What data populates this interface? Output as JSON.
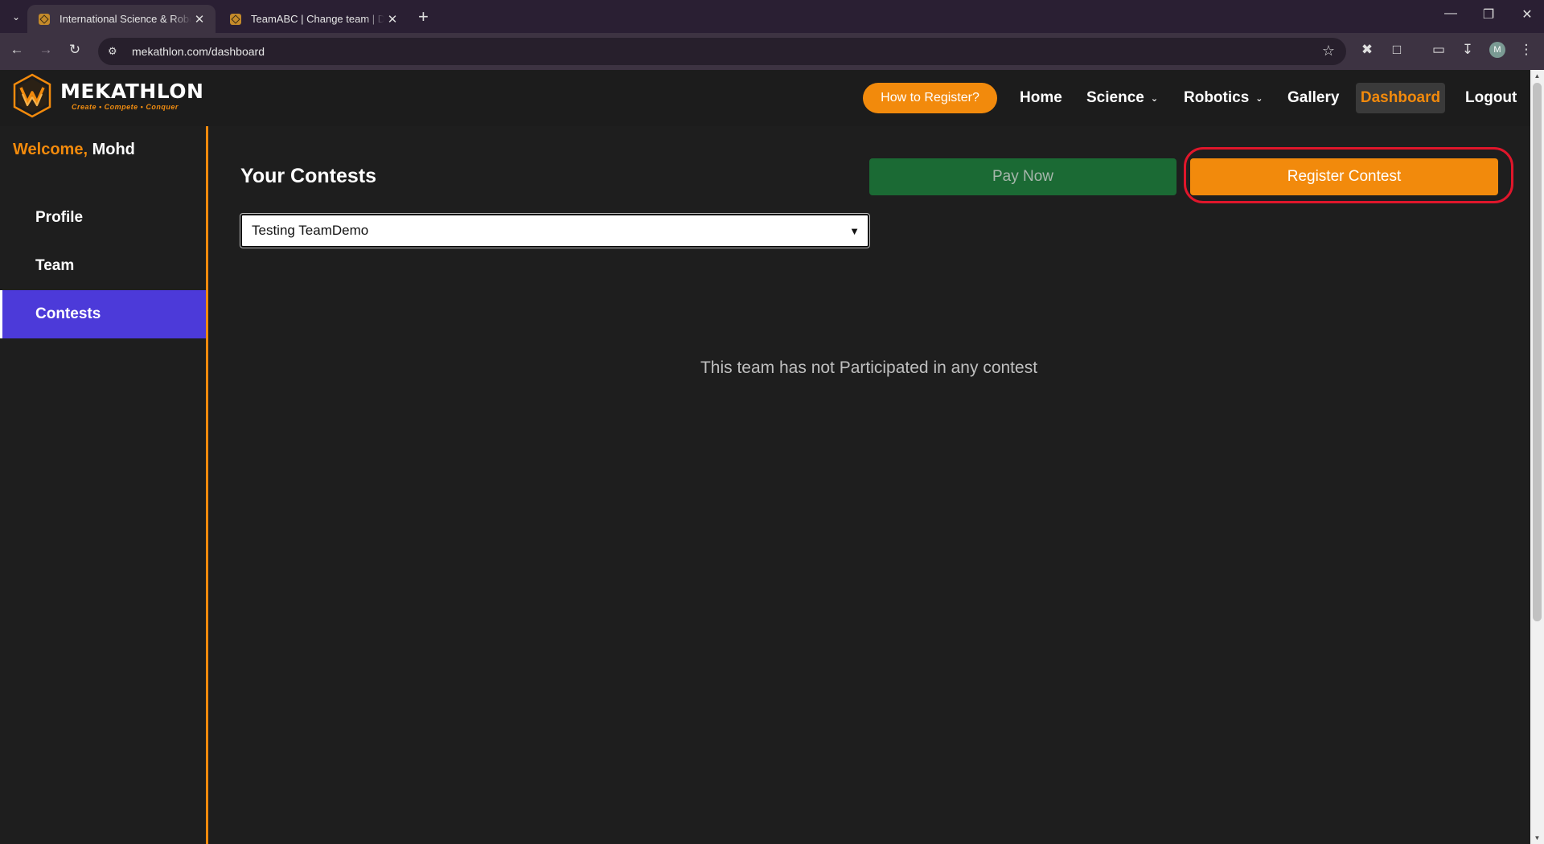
{
  "browser": {
    "tabs": [
      {
        "title": "International Science & Robotics",
        "active": true
      },
      {
        "title": "TeamABC | Change team | Django",
        "active": false
      }
    ],
    "url": "mekathlon.com/dashboard",
    "profile_initial": "M"
  },
  "header": {
    "logo_name": "MEKATHLON",
    "logo_tagline": "Create • Compete • Conquer",
    "how_to_register": "How to Register?",
    "nav": {
      "home": "Home",
      "science": "Science",
      "robotics": "Robotics",
      "gallery": "Gallery",
      "dashboard": "Dashboard",
      "logout": "Logout"
    }
  },
  "sidebar": {
    "welcome_label": "Welcome,",
    "user_name": "Mohd",
    "items": [
      {
        "label": "Profile",
        "active": false
      },
      {
        "label": "Team",
        "active": false
      },
      {
        "label": "Contests",
        "active": true
      }
    ]
  },
  "main": {
    "title": "Your Contests",
    "pay_now": "Pay Now",
    "register_contest": "Register Contest",
    "team_select_value": "Testing TeamDemo",
    "empty_message": "This team has not Participated in any contest"
  },
  "colors": {
    "accent": "#f28a0c",
    "active_sidebar": "#4c3ad9",
    "pay_button": "#1b6a34",
    "highlight": "#e0162b"
  }
}
